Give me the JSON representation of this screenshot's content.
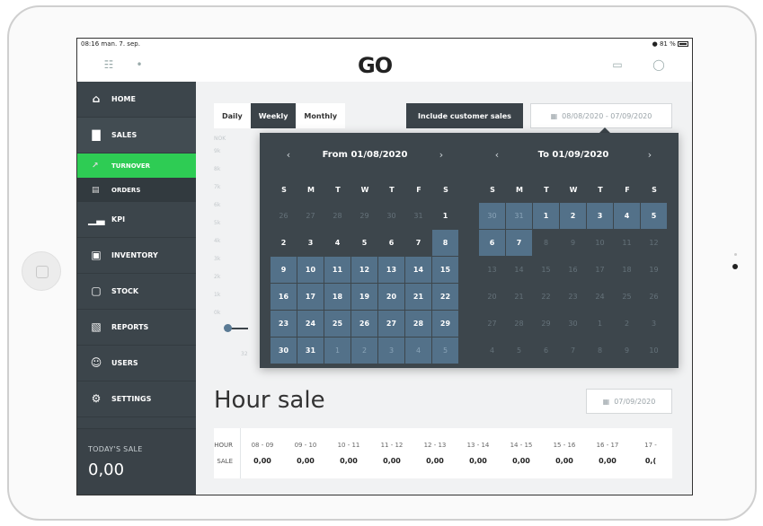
{
  "status_bar": {
    "time_date": "08:16 man. 7. sep.",
    "battery": "81 %"
  },
  "header": {
    "logo": "GO"
  },
  "sidebar": {
    "items": [
      {
        "label": "HOME",
        "icon": "home-icon"
      },
      {
        "label": "SALES",
        "icon": "sales-chart-icon"
      },
      {
        "label": "TURNOVER",
        "icon": "trend-icon",
        "sub": true,
        "active": true
      },
      {
        "label": "ORDERS",
        "icon": "document-icon",
        "sub": true
      },
      {
        "label": "KPI",
        "icon": "bar-chart-icon"
      },
      {
        "label": "INVENTORY",
        "icon": "inventory-icon"
      },
      {
        "label": "STOCK",
        "icon": "stock-icon"
      },
      {
        "label": "REPORTS",
        "icon": "reports-icon"
      },
      {
        "label": "USERS",
        "icon": "users-icon"
      },
      {
        "label": "SETTINGS",
        "icon": "gear-icon"
      }
    ],
    "todays_sale": {
      "label": "TODAY'S SALE",
      "value": "0,00"
    }
  },
  "toolbar": {
    "daily": "Daily",
    "weekly": "Weekly",
    "monthly": "Monthly",
    "include_customer_sales": "Include customer sales",
    "date_range": "08/08/2020 - 07/09/2020"
  },
  "chart": {
    "y_ticks": [
      "NOK",
      "9k",
      "8k",
      "7k",
      "6k",
      "5k",
      "4k",
      "3k",
      "2k",
      "1k",
      "0k"
    ],
    "x_tick": "32"
  },
  "datepicker": {
    "from_title": "From 01/08/2020",
    "to_title": "To 01/09/2020",
    "dow": [
      "S",
      "M",
      "T",
      "W",
      "T",
      "F",
      "S"
    ],
    "from_days": [
      [
        "26",
        "out"
      ],
      [
        "27",
        "out"
      ],
      [
        "28",
        "out"
      ],
      [
        "29",
        "out"
      ],
      [
        "30",
        "out"
      ],
      [
        "31",
        "out"
      ],
      [
        "1",
        "in"
      ],
      [
        "2",
        "in"
      ],
      [
        "3",
        "in"
      ],
      [
        "4",
        "in"
      ],
      [
        "5",
        "in"
      ],
      [
        "6",
        "in"
      ],
      [
        "7",
        "in"
      ],
      [
        "8",
        "sel"
      ],
      [
        "9",
        "sel"
      ],
      [
        "10",
        "sel"
      ],
      [
        "11",
        "sel"
      ],
      [
        "12",
        "sel"
      ],
      [
        "13",
        "sel"
      ],
      [
        "14",
        "sel"
      ],
      [
        "15",
        "sel"
      ],
      [
        "16",
        "sel"
      ],
      [
        "17",
        "sel"
      ],
      [
        "18",
        "sel"
      ],
      [
        "19",
        "sel"
      ],
      [
        "20",
        "sel"
      ],
      [
        "21",
        "sel"
      ],
      [
        "22",
        "sel"
      ],
      [
        "23",
        "sel"
      ],
      [
        "24",
        "sel"
      ],
      [
        "25",
        "sel"
      ],
      [
        "26",
        "sel"
      ],
      [
        "27",
        "sel"
      ],
      [
        "28",
        "sel"
      ],
      [
        "29",
        "sel"
      ],
      [
        "30",
        "sel"
      ],
      [
        "31",
        "sel"
      ],
      [
        "1",
        "selout"
      ],
      [
        "2",
        "selout"
      ],
      [
        "3",
        "selout"
      ],
      [
        "4",
        "selout"
      ],
      [
        "5",
        "selout"
      ]
    ],
    "to_days": [
      [
        "30",
        "selout"
      ],
      [
        "31",
        "selout"
      ],
      [
        "1",
        "sel"
      ],
      [
        "2",
        "sel"
      ],
      [
        "3",
        "sel"
      ],
      [
        "4",
        "sel"
      ],
      [
        "5",
        "sel"
      ],
      [
        "6",
        "sel"
      ],
      [
        "7",
        "sel"
      ],
      [
        "8",
        "dim"
      ],
      [
        "9",
        "dim"
      ],
      [
        "10",
        "dim"
      ],
      [
        "11",
        "dim"
      ],
      [
        "12",
        "dim"
      ],
      [
        "13",
        "dim"
      ],
      [
        "14",
        "dim"
      ],
      [
        "15",
        "dim"
      ],
      [
        "16",
        "dim"
      ],
      [
        "17",
        "dim"
      ],
      [
        "18",
        "dim"
      ],
      [
        "19",
        "dim"
      ],
      [
        "20",
        "dim"
      ],
      [
        "21",
        "dim"
      ],
      [
        "22",
        "dim"
      ],
      [
        "23",
        "dim"
      ],
      [
        "24",
        "dim"
      ],
      [
        "25",
        "dim"
      ],
      [
        "26",
        "dim"
      ],
      [
        "27",
        "dim"
      ],
      [
        "28",
        "dim"
      ],
      [
        "29",
        "dim"
      ],
      [
        "30",
        "dim"
      ],
      [
        "1",
        "dim"
      ],
      [
        "2",
        "dim"
      ],
      [
        "3",
        "dim"
      ],
      [
        "4",
        "dim"
      ],
      [
        "5",
        "dim"
      ],
      [
        "6",
        "dim"
      ],
      [
        "7",
        "dim"
      ],
      [
        "8",
        "dim"
      ],
      [
        "9",
        "dim"
      ],
      [
        "10",
        "dim"
      ]
    ]
  },
  "hour_sale": {
    "title": "Hour sale",
    "date": "07/09/2020",
    "row_labels": {
      "hour": "HOUR",
      "sale": "SALE"
    },
    "columns": [
      {
        "hour": "08 - 09",
        "sale": "0,00"
      },
      {
        "hour": "09 - 10",
        "sale": "0,00"
      },
      {
        "hour": "10 - 11",
        "sale": "0,00"
      },
      {
        "hour": "11 - 12",
        "sale": "0,00"
      },
      {
        "hour": "12 - 13",
        "sale": "0,00"
      },
      {
        "hour": "13 - 14",
        "sale": "0,00"
      },
      {
        "hour": "14 - 15",
        "sale": "0,00"
      },
      {
        "hour": "15 - 16",
        "sale": "0,00"
      },
      {
        "hour": "16 - 17",
        "sale": "0,00"
      },
      {
        "hour": "17 -",
        "sale": "0,("
      }
    ]
  }
}
